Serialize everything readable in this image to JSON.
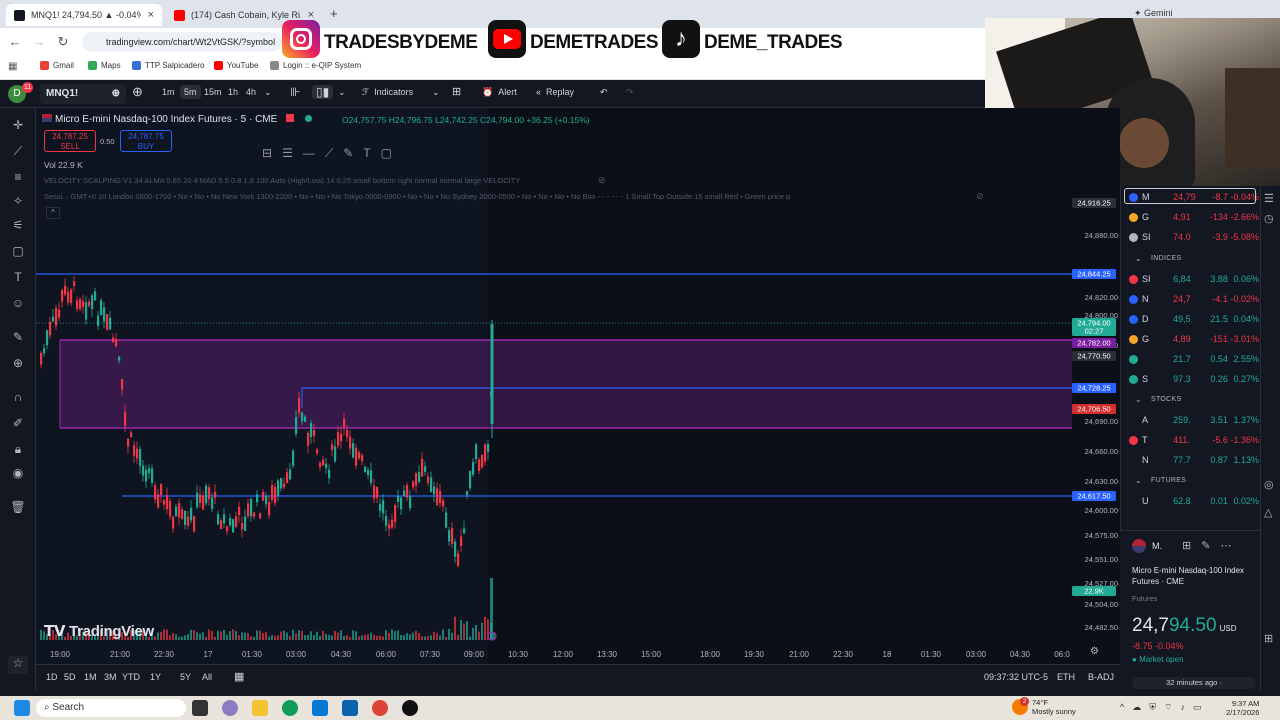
{
  "browser": {
    "tabs": [
      {
        "label": "MNQ1! 24,794.50 ▲ -0.04% U..."
      },
      {
        "label": "(174) Cash Cobain, Kyle Ri..."
      }
    ],
    "url": "tradingview.com/chart/Wt2VtGSK/?symbol",
    "bookmarks": [
      "Gmail",
      "Maps",
      "TTP Salpicadero",
      "YouTube",
      "Login :: e-QIP System"
    ],
    "gemini_label": "Gemini"
  },
  "overlay": {
    "instagram": "TRADESBYDEME",
    "youtube": "DEMETRADES",
    "tiktok": "DEME_TRADES"
  },
  "toolbar": {
    "symbol": "MNQ1!",
    "intervals": [
      "1m",
      "5m",
      "15m",
      "1h",
      "4h"
    ],
    "indicators": "Indicators",
    "alert": "Alert",
    "replay": "Replay"
  },
  "chart": {
    "symbol_title": "Micro E-mini Nasdaq-100 Index Futures · 5 · CME",
    "ohlc": "O24,757.75 H24,796.75 L24,742.25 C24,794.00 +36.25 (+0.15%)",
    "sell_price": "24,787.25",
    "sell_label": "SELL",
    "spread": "0.50",
    "buy_price": "24,787.75",
    "buy_label": "BUY",
    "volume": "Vol 22.9 K",
    "indicator1": "VELOCITY SCALPING V1 34 ALMA 0.65 20 4 MAD 5 5 0.8 1.8 100 Auto (High/Low) 14 0.25 small bottom right normal normal large VELOCITY",
    "indicator2": "Sessi... GMT+0 10 London 0800-1700 • No • No • No New York 1300-2200 • No • No • No Tokyo 0000-0900 • No • No • No Sydney 2000-0500 • No • No • No • No Box - - - - - - 1 Small Top Outside 15 small Red • Green price p",
    "watermark": "TradingView",
    "price_axis": [
      "24,880.00",
      "24,820.00",
      "24,800.00",
      "24,750.00",
      "24,690.00",
      "24,660.00",
      "24,630.00",
      "24,600.00",
      "24,575.00",
      "24,551.00",
      "24,527.00",
      "24,504.00",
      "24,482.50"
    ],
    "price_tags": [
      {
        "label": "24,916.25",
        "color": "#2a2e39"
      },
      {
        "label": "24,844.25",
        "color": "#2962ff"
      },
      {
        "label": "24,794.00",
        "color": "#22ab94"
      },
      {
        "label": "02:27",
        "color": "#22ab94"
      },
      {
        "label": "24,782.00",
        "color": "#7b1fa2"
      },
      {
        "label": "24,770.50",
        "color": "#2a2e39"
      },
      {
        "label": "24,728.25",
        "color": "#2962ff"
      },
      {
        "label": "24,706.50",
        "color": "#d32f2f"
      },
      {
        "label": "24,617.50",
        "color": "#2962ff"
      },
      {
        "label": "22.9K",
        "color": "#22ab94"
      }
    ],
    "time_axis": [
      "19:00",
      "21:00",
      "22:30",
      "17",
      "01:30",
      "03:00",
      "04:30",
      "06:00",
      "07:30",
      "09:00",
      "10:30",
      "12:00",
      "13:30",
      "15:00",
      "18:00",
      "19:30",
      "21:00",
      "22:30",
      "18",
      "01:30",
      "03:00",
      "04:30",
      "06:0"
    ],
    "zone_color": "#9c27b0",
    "line_color": "#2962ff"
  },
  "watchlist": {
    "top": [
      {
        "sym": "M",
        "last": "24,79",
        "chg": "-8.7",
        "pct": "-0.04%",
        "color": "#f23645",
        "dot": "#2962ff"
      },
      {
        "sym": "G",
        "last": "4,91",
        "chg": "-134",
        "pct": "-2.66%",
        "color": "#f23645",
        "dot": "#f5a623"
      },
      {
        "sym": "SI",
        "last": "74.0",
        "chg": "-3.9",
        "pct": "-5.08%",
        "color": "#f23645",
        "dot": "#b2b5be"
      }
    ],
    "indices_label": "INDICES",
    "indices": [
      {
        "sym": "SI",
        "last": "6,84",
        "chg": "3.88",
        "pct": "0.06%",
        "color": "#22ab94",
        "dot": "#f23645"
      },
      {
        "sym": "N",
        "last": "24,7",
        "chg": "-4.1",
        "pct": "-0.02%",
        "color": "#f23645",
        "dot": "#2962ff"
      },
      {
        "sym": "D",
        "last": "49,5",
        "chg": "21.5",
        "pct": "0.04%",
        "color": "#22ab94",
        "dot": "#2962ff"
      },
      {
        "sym": "G",
        "last": "4,89",
        "chg": "-151",
        "pct": "-3.01%",
        "color": "#f23645",
        "dot": "#f5a623"
      },
      {
        "sym": "",
        "last": "21.7",
        "chg": "0.54",
        "pct": "2.55%",
        "color": "#22ab94",
        "dot": "#22ab94"
      },
      {
        "sym": "S",
        "last": "97.3",
        "chg": "0.26",
        "pct": "0.27%",
        "color": "#22ab94",
        "dot": "#22ab94"
      }
    ],
    "stocks_label": "STOCKS",
    "stocks": [
      {
        "sym": "A",
        "last": "259.",
        "chg": "3.51",
        "pct": "1.37%",
        "color": "#22ab94",
        "dot": "#131722"
      },
      {
        "sym": "T",
        "last": "411.",
        "chg": "-5.6",
        "pct": "-1.36%",
        "color": "#f23645",
        "dot": "#f23645"
      },
      {
        "sym": "N",
        "last": "77.7",
        "chg": "0.87",
        "pct": "1.13%",
        "color": "#22ab94",
        "dot": "#131722"
      }
    ],
    "futures_label": "FUTURES",
    "futures": [
      {
        "sym": "U",
        "last": "62.8",
        "chg": "0.01",
        "pct": "0.02%",
        "color": "#22ab94",
        "dot": "#131722"
      }
    ],
    "detail_symbol": "M.",
    "detail_name": "Micro E-mini Nasdaq-100 Index Futures · CME",
    "detail_type": "Futures",
    "detail_price_big": "24,7",
    "detail_price_small": "94.50",
    "detail_currency": "USD",
    "detail_change": "-8.75 -0.04%",
    "detail_status": "Market open",
    "detail_news": "32 minutes ago ·"
  },
  "bottom": {
    "ranges": [
      "1D",
      "5D",
      "1M",
      "3M",
      "YTD",
      "1Y",
      "5Y",
      "All"
    ],
    "clock": "09:37:32 UTC-5",
    "session": "ETH",
    "adj": "B-ADJ"
  },
  "taskbar": {
    "search": "Search",
    "weather_temp": "74°F",
    "weather_desc": "Mostly sunny",
    "time": "9:37 AM",
    "date": "2/17/2026",
    "badge": "2"
  }
}
